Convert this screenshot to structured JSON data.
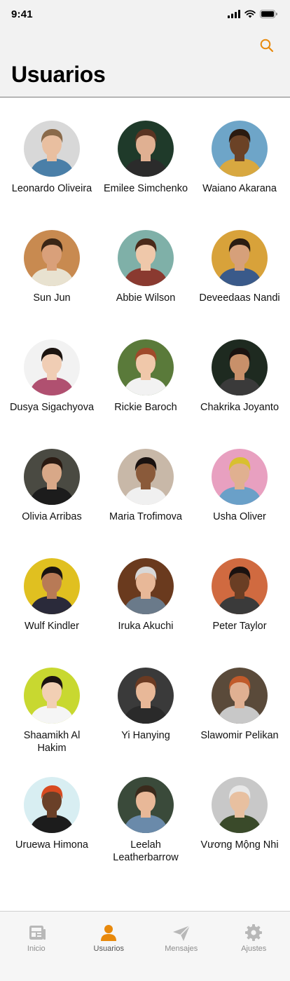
{
  "status_bar": {
    "time": "9:41"
  },
  "header": {
    "title": "Usuarios",
    "search_icon": "search-icon"
  },
  "colors": {
    "accent": "#e8890c",
    "header_bg": "#f2f2f2",
    "tab_inactive": "#b8b8b8"
  },
  "users": [
    {
      "name": "Leonardo Oliveira",
      "bg": "#d8d8d8",
      "skin": "#e9bfa0",
      "hair": "#8a6a4a",
      "shirt": "#4a7fa8"
    },
    {
      "name": "Emilee Simchenko",
      "bg": "#1f3a2a",
      "skin": "#e0b092",
      "hair": "#5a3422",
      "shirt": "#2b2b2b"
    },
    {
      "name": "Waiano Akarana",
      "bg": "#6ea5c8",
      "skin": "#6b4226",
      "hair": "#2a1a10",
      "shirt": "#d8a840"
    },
    {
      "name": "Sun Jun",
      "bg": "#c88a50",
      "skin": "#d9a07a",
      "hair": "#3a2616",
      "shirt": "#e8e2d0"
    },
    {
      "name": "Abbie Wilson",
      "bg": "#7fb0a8",
      "skin": "#efc8aa",
      "hair": "#4a2a1a",
      "shirt": "#8a3a30"
    },
    {
      "name": "Deveedaas Nandi",
      "bg": "#d8a23a",
      "skin": "#d6a07a",
      "hair": "#2a1c12",
      "shirt": "#3a5a8a"
    },
    {
      "name": "Dusya Sigachyova",
      "bg": "#f2f2f2",
      "skin": "#f0cdb4",
      "hair": "#1c1410",
      "shirt": "#b05070"
    },
    {
      "name": "Rickie Baroch",
      "bg": "#5a7a3a",
      "skin": "#f0c8aa",
      "hair": "#a04a2a",
      "shirt": "#f2f2f2"
    },
    {
      "name": "Chakrika Joyanto",
      "bg": "#1e2a20",
      "skin": "#c8906a",
      "hair": "#1a1210",
      "shirt": "#3a3a3a"
    },
    {
      "name": "Olivia Arribas",
      "bg": "#4a4a42",
      "skin": "#d8a888",
      "hair": "#2a1a12",
      "shirt": "#1c1c1c"
    },
    {
      "name": "Maria Trofimova",
      "bg": "#c8b8a8",
      "skin": "#8a5a3a",
      "hair": "#1a1210",
      "shirt": "#f0f0f0"
    },
    {
      "name": "Usha Oliver",
      "bg": "#e8a0c0",
      "skin": "#e0b090",
      "hair": "#d8c030",
      "shirt": "#6aa0c8"
    },
    {
      "name": "Wulf Kindler",
      "bg": "#e0c020",
      "skin": "#b87a56",
      "hair": "#1a1412",
      "shirt": "#2a2a3a"
    },
    {
      "name": "Iruka Akuchi",
      "bg": "#6a3a1e",
      "skin": "#e8b898",
      "hair": "#d8d8d8",
      "shirt": "#6a7a8a"
    },
    {
      "name": "Peter Taylor",
      "bg": "#d06a40",
      "skin": "#6a3e24",
      "hair": "#1a1210",
      "shirt": "#3a3a3a"
    },
    {
      "name": "Shaamikh Al Hakim",
      "bg": "#c8d830",
      "skin": "#f2cfb4",
      "hair": "#1c1412",
      "shirt": "#f5f5f5"
    },
    {
      "name": "Yi Hanying",
      "bg": "#3a3a3a",
      "skin": "#e8b898",
      "hair": "#6a3a22",
      "shirt": "#2a2a2a"
    },
    {
      "name": "Slawomir Pelikan",
      "bg": "#5a4a3a",
      "skin": "#e0b092",
      "hair": "#c05a2a",
      "shirt": "#c8c8c8"
    },
    {
      "name": "Uruewa Himona",
      "bg": "#d8eef2",
      "skin": "#6a4028",
      "hair": "#d84a20",
      "shirt": "#1c1c1c"
    },
    {
      "name": "Leelah Leatherbarrow",
      "bg": "#3a4a3a",
      "skin": "#e8b898",
      "hair": "#3a2a1c",
      "shirt": "#6a8aaa"
    },
    {
      "name": "Vương Mộng Nhi",
      "bg": "#c8c8c8",
      "skin": "#e8c0a0",
      "hair": "#e8e8e8",
      "shirt": "#3a4a2a"
    }
  ],
  "tabbar": {
    "tabs": [
      {
        "label": "Inicio",
        "icon": "news-icon",
        "active": false
      },
      {
        "label": "Usuarios",
        "icon": "person-icon",
        "active": true
      },
      {
        "label": "Mensajes",
        "icon": "paper-plane-icon",
        "active": false
      },
      {
        "label": "Ajustes",
        "icon": "gear-icon",
        "active": false
      }
    ]
  }
}
